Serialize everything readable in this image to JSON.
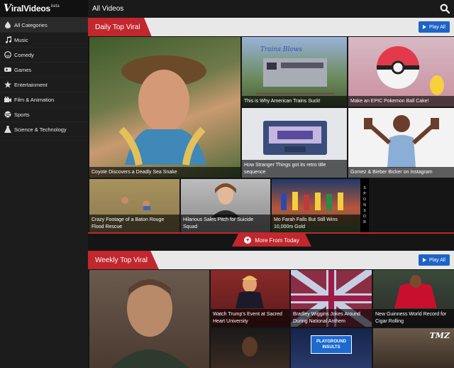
{
  "logo": {
    "mark": "V",
    "text": "iralVideos",
    "beta": "beta"
  },
  "topbar": {
    "title": "All Videos"
  },
  "sidebar": {
    "items": [
      {
        "label": "All Categories",
        "icon": "drop-icon"
      },
      {
        "label": "Music",
        "icon": "music-note-icon"
      },
      {
        "label": "Comedy",
        "icon": "smiley-icon"
      },
      {
        "label": "Games",
        "icon": "gamepad-icon"
      },
      {
        "label": "Entertainment",
        "icon": "star-icon"
      },
      {
        "label": "Film & Animation",
        "icon": "film-icon"
      },
      {
        "label": "Sports",
        "icon": "ball-icon"
      },
      {
        "label": "Science & Technology",
        "icon": "flask-icon"
      }
    ]
  },
  "daily": {
    "title": "Daily Top Viral",
    "play_all": "Play All",
    "tiles": [
      {
        "caption": "Coyote Discovers a Deadly Sea Snake",
        "color": "#5d6b3a"
      },
      {
        "caption": "This is Why American Trains Suck!",
        "color": "#3c5a8a",
        "overlay": "Trains Blows"
      },
      {
        "caption": "Make an EPIC Pokemon Ball Cake!",
        "color": "#e5b6c2"
      },
      {
        "caption": "How Stranger Things got its retro title sequence",
        "color": "#d9dbe0"
      },
      {
        "caption": "Gomez & Bieber Bicker on Instagram",
        "color": "#eeeeee"
      },
      {
        "caption": "Crazy Footage of a Baton Rouge Flood Rescue",
        "color": "#8a7a4e"
      },
      {
        "caption": "Hilarious Sales Pitch for Suicide Squad",
        "color": "#9a9a9a"
      },
      {
        "caption": "Mo Farah Falls But Still Wins 10,000m Gold",
        "color": "#3b6a3a"
      }
    ],
    "sponsor": [
      "S",
      "P",
      "O",
      "N",
      "S",
      "O",
      "R"
    ],
    "more": "More From Today"
  },
  "weekly": {
    "title": "Weekly Top Viral",
    "play_all": "Play All",
    "tiles": [
      {
        "caption": "",
        "color": "#5c4a3e"
      },
      {
        "caption": "Watch Trump's Event at Sacred Heart University",
        "color": "#7a2a2a"
      },
      {
        "caption": "Bradley Wiggins Jokes Around During National Anthem",
        "color": "#b02a2e"
      },
      {
        "caption": "New Guinness World Record for Cigar Rolling",
        "color": "#2e3a2a"
      },
      {
        "caption": "",
        "color": "#2a2a2a"
      },
      {
        "caption": "",
        "color": "#1a2a4a",
        "overlay": "PLAYGROUND INSULTS"
      },
      {
        "caption": "",
        "color": "#5a4a3a",
        "overlay": "TMZ"
      }
    ]
  }
}
